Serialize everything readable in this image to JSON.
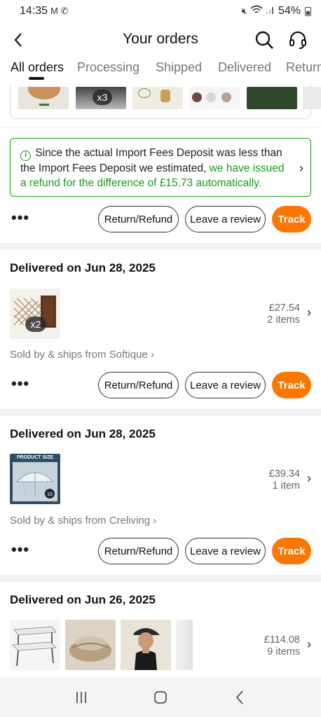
{
  "status_bar": {
    "time": "14:35",
    "left_icons": "M ✆",
    "battery": "54%"
  },
  "header": {
    "title": "Your orders"
  },
  "tabs": [
    {
      "label": "All orders",
      "active": true
    },
    {
      "label": "Processing"
    },
    {
      "label": "Shipped"
    },
    {
      "label": "Delivered"
    },
    {
      "label": "Return"
    }
  ],
  "top_thumb_badge": "x3",
  "notice": {
    "text_plain": "Since the actual Import Fees Deposit was less than the Import Fees Deposit we estimated,",
    "text_green": "we have issued a refund for the difference of £15.73 automatically."
  },
  "actions": {
    "more": "•••",
    "return_label": "Return/Refund",
    "review_label": "Leave a review",
    "track_label": "Track"
  },
  "orders": [
    {
      "title": "Delivered on Jun 28, 2025",
      "qty_badge": "x2",
      "price": "£27.54",
      "items": "2 items",
      "seller": "Sold by & ships from Softique"
    },
    {
      "title": "Delivered on Jun 28, 2025",
      "img_label": "PRODUCT SIZE",
      "price": "£39.34",
      "items": "1 item",
      "seller": "Sold by & ships from Creliving"
    },
    {
      "title": "Delivered on Jun 26, 2025",
      "price": "£114.08",
      "items": "9 items"
    }
  ],
  "colors": {
    "accent": "#fb7701",
    "success": "#1a9a1a"
  }
}
